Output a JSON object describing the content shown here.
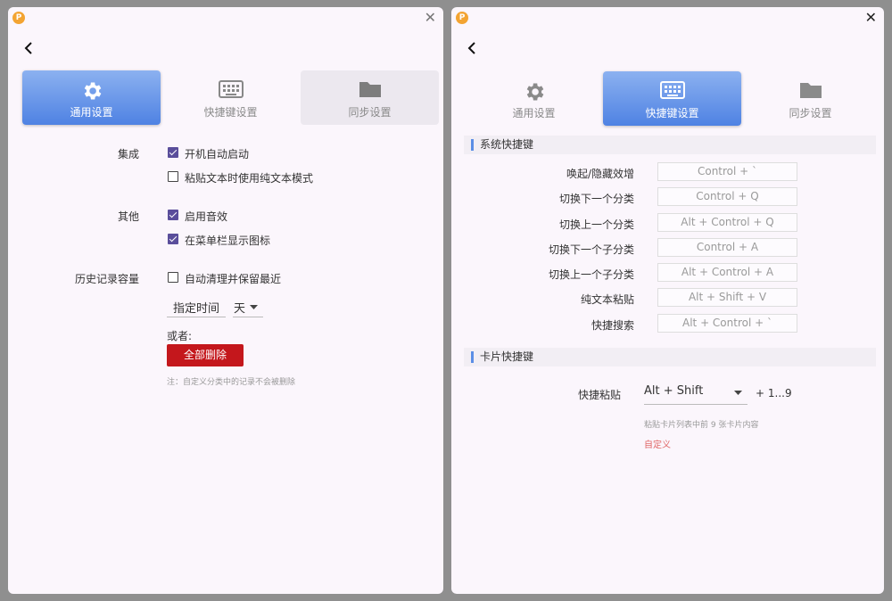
{
  "left_window": {
    "back_icon": "chevron-left-icon",
    "close_icon": "close-icon",
    "tabs": [
      {
        "label": "通用设置",
        "icon": "gear-icon",
        "state": "active"
      },
      {
        "label": "快捷键设置",
        "icon": "keyboard-icon",
        "state": "normal"
      },
      {
        "label": "同步设置",
        "icon": "folder-icon",
        "state": "disabled"
      }
    ],
    "integration": {
      "label": "集成",
      "options": [
        {
          "label": "开机自动启动",
          "checked": true
        },
        {
          "label": "粘贴文本时使用纯文本模式",
          "checked": false
        }
      ]
    },
    "other": {
      "label": "其他",
      "options": [
        {
          "label": "启用音效",
          "checked": true
        },
        {
          "label": "在菜单栏显示图标",
          "checked": true
        }
      ]
    },
    "history": {
      "label": "历史记录容量",
      "auto_clear": {
        "label": "自动清理并保留最近",
        "checked": false
      },
      "time_value": "指定时间",
      "unit_value": "天",
      "or_label": "或者:",
      "delete_all_label": "全部删除",
      "note": "注：自定义分类中的记录不会被删除"
    }
  },
  "right_window": {
    "back_icon": "chevron-left-icon",
    "close_icon": "close-icon",
    "tabs": [
      {
        "label": "通用设置",
        "icon": "gear-icon",
        "state": "normal"
      },
      {
        "label": "快捷键设置",
        "icon": "keyboard-icon",
        "state": "active"
      },
      {
        "label": "同步设置",
        "icon": "folder-icon",
        "state": "normal"
      }
    ],
    "system_section": {
      "title": "系统快捷键",
      "shortcuts": [
        {
          "label": "唤起/隐藏效增",
          "keys": "Control + `"
        },
        {
          "label": "切换下一个分类",
          "keys": "Control + Q"
        },
        {
          "label": "切换上一个分类",
          "keys": "Alt + Control + Q"
        },
        {
          "label": "切换下一个子分类",
          "keys": "Control + A"
        },
        {
          "label": "切换上一个子分类",
          "keys": "Alt + Control + A"
        },
        {
          "label": "纯文本粘贴",
          "keys": "Alt + Shift + V"
        },
        {
          "label": "快捷搜索",
          "keys": "Alt + Control + `"
        }
      ]
    },
    "card_section": {
      "title": "卡片快捷键",
      "quick_paste_label": "快捷粘贴",
      "modifier_value": "Alt + Shift",
      "suffix": "+ 1...9",
      "hint": "粘贴卡片列表中前 9 张卡片内容",
      "custom_link": "自定义"
    }
  },
  "colors": {
    "accent_blue": "#4f82e3",
    "checkbox_purple": "#5a4e9b",
    "danger_red": "#c4171c",
    "window_bg": "#fbf6fc"
  }
}
